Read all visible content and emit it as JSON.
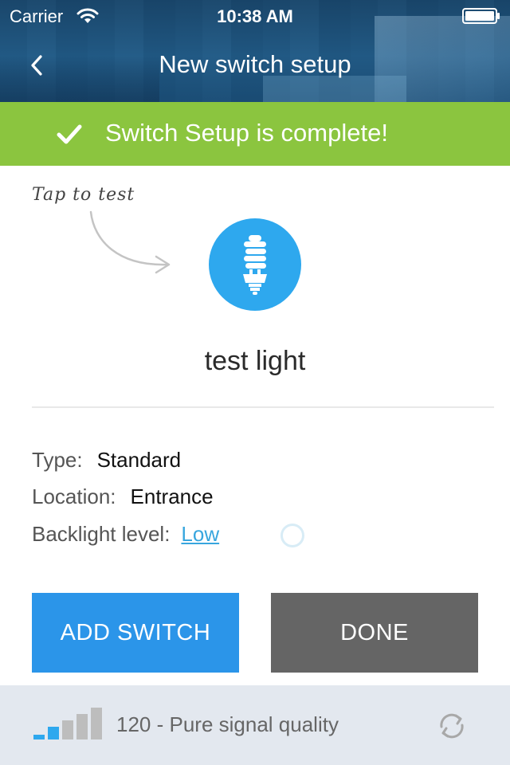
{
  "status_bar": {
    "carrier": "Carrier",
    "time": "10:38 AM"
  },
  "nav": {
    "title": "New switch setup",
    "back_icon": "chevron-left-icon"
  },
  "banner": {
    "text": "Switch Setup is complete!",
    "icon": "checkmark-icon",
    "color": "#8bc53f"
  },
  "test": {
    "hint": "Tap to test",
    "bulb_icon": "lightbulb-icon",
    "bulb_color": "#2ea8ee",
    "device_name": "test light"
  },
  "details": {
    "type_label": "Type:",
    "type_value": "Standard",
    "location_label": "Location:",
    "location_value": "Entrance",
    "backlight_label": "Backlight level:",
    "backlight_value": "Low"
  },
  "buttons": {
    "add_switch": "ADD SWITCH",
    "done": "DONE",
    "add_color": "#2b95e9",
    "done_color": "#656565"
  },
  "footer": {
    "signal_text": "120 - Pure signal quality",
    "signal_bars_active": 2,
    "signal_bars_total": 5,
    "refresh_icon": "refresh-icon"
  }
}
